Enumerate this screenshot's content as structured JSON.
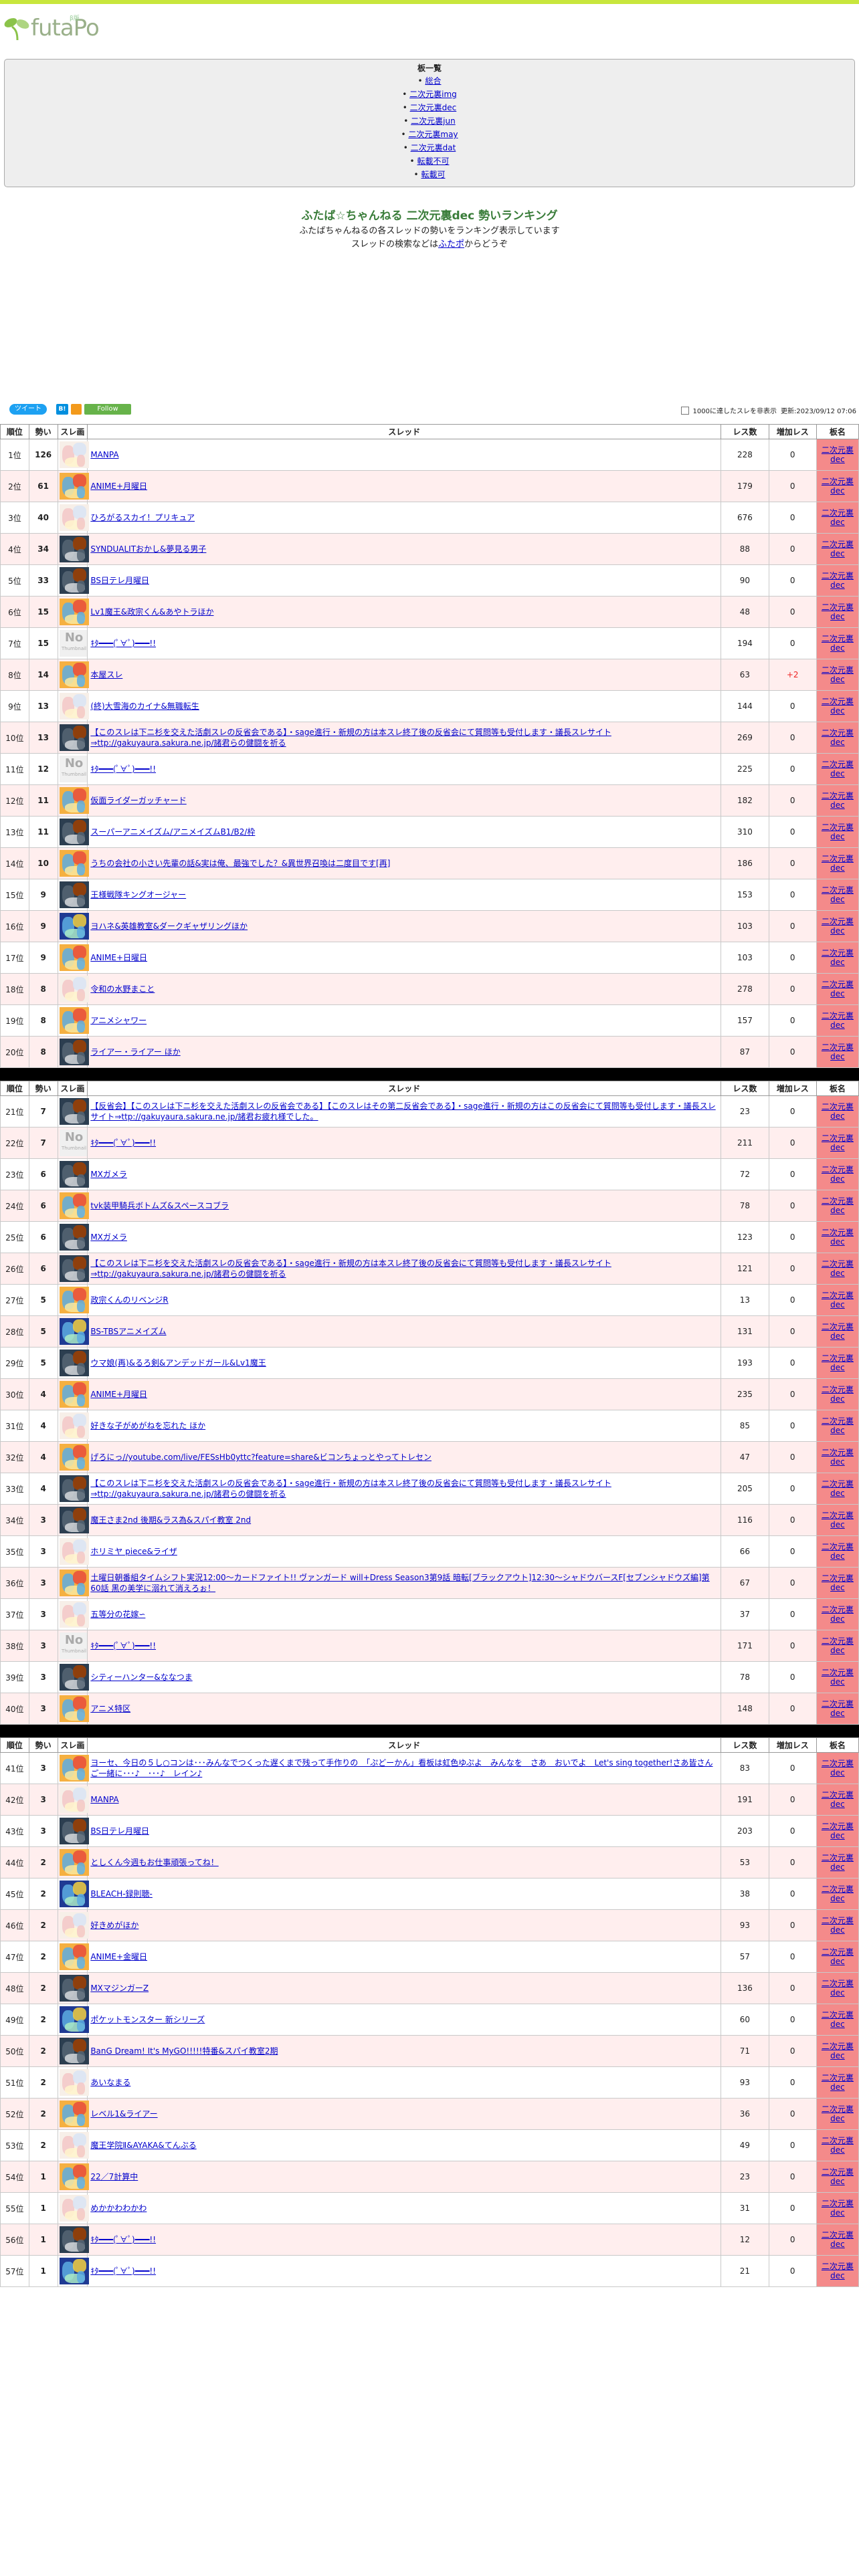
{
  "site": {
    "logo_text": "futaPo",
    "logo_small": "β版"
  },
  "menu": {
    "title": "板一覧",
    "items": [
      {
        "label": "総合"
      },
      {
        "label": "二次元裏img"
      },
      {
        "label": "二次元裏dec"
      },
      {
        "label": "二次元裏jun"
      },
      {
        "label": "二次元裏may"
      },
      {
        "label": "二次元裏dat"
      },
      {
        "label": "転載不可"
      },
      {
        "label": "転載可"
      }
    ]
  },
  "intro": {
    "title": "ふたば☆ちゃんねる 二次元裏dec 勢いランキング",
    "line1": "ふたばちゃんねるの各スレッドの勢いをランキング表示しています",
    "line2_pre": "スレッドの検索などは",
    "line2_link": "ふたポ",
    "line2_post": "からどうぞ"
  },
  "toolbar": {
    "tweet_label": "ツイート",
    "hatena_label": "B!",
    "follow_label": "Follow",
    "hide_label": "1000に達したスレを非表示",
    "updated_label": "更新:2023/09/12 07:06"
  },
  "table": {
    "headers": [
      "順位",
      "勢い",
      "スレ画",
      "スレッド",
      "レス数",
      "増加レス",
      "板名"
    ],
    "board_line1": "二次元裏",
    "board_line2": "dec"
  },
  "rows": [
    {
      "rank": "1位",
      "mom": "126",
      "title": "MANPA",
      "res": "228",
      "inc": "0",
      "thumb": "light"
    },
    {
      "rank": "2位",
      "mom": "61",
      "title": "ANIME+月曜日",
      "res": "179",
      "inc": "0",
      "thumb": "colorful"
    },
    {
      "rank": "3位",
      "mom": "40",
      "title": "ひろがるスカイ！プリキュア",
      "res": "676",
      "inc": "0",
      "thumb": "light"
    },
    {
      "rank": "4位",
      "mom": "34",
      "title": "SYNDUALITおかし&夢見る男子",
      "res": "88",
      "inc": "0",
      "thumb": "dark"
    },
    {
      "rank": "5位",
      "mom": "33",
      "title": "BS日テレ月曜日",
      "res": "90",
      "inc": "0",
      "thumb": "dark"
    },
    {
      "rank": "6位",
      "mom": "15",
      "title": "Lv1魔王&政宗くん&あやトラほか",
      "res": "48",
      "inc": "0",
      "thumb": "colorful"
    },
    {
      "rank": "7位",
      "mom": "15",
      "title": "ｷﾀ━━━(ﾟ∀ﾟ)━━━!!",
      "res": "194",
      "inc": "0",
      "thumb": "none"
    },
    {
      "rank": "8位",
      "mom": "14",
      "title": "本屋スレ",
      "res": "63",
      "inc": "+2",
      "thumb": "colorful"
    },
    {
      "rank": "9位",
      "mom": "13",
      "title": "(終)大雪海のカイナ&無職転生",
      "res": "144",
      "inc": "0",
      "thumb": "light"
    },
    {
      "rank": "10位",
      "mom": "13",
      "title": "【このスレは下ニ杉を交えた活劇スレの反省会である】・sage進行・新規の方は本スレ終了後の反省会にて質問等も受付します・議長スレサイト⇒ttp://gakuyaura.sakura.ne.jp/諸君らの健闘を祈る",
      "res": "269",
      "inc": "0",
      "thumb": "dark"
    },
    {
      "rank": "11位",
      "mom": "12",
      "title": "ｷﾀ━━━(ﾟ∀ﾟ)━━━!!",
      "res": "225",
      "inc": "0",
      "thumb": "none"
    },
    {
      "rank": "12位",
      "mom": "11",
      "title": "仮面ライダーガッチャード",
      "res": "182",
      "inc": "0",
      "thumb": "colorful"
    },
    {
      "rank": "13位",
      "mom": "11",
      "title": "スーパーアニメイズム/アニメイズムB1/B2/枠",
      "res": "310",
      "inc": "0",
      "thumb": "dark"
    },
    {
      "rank": "14位",
      "mom": "10",
      "title": "うちの会社の小さい先輩の話&実は俺、最強でした？&異世界召喚は二度目です[再]",
      "res": "186",
      "inc": "0",
      "thumb": "colorful"
    },
    {
      "rank": "15位",
      "mom": "9",
      "title": "王様戦隊キングオージャー",
      "res": "153",
      "inc": "0",
      "thumb": "dark"
    },
    {
      "rank": "16位",
      "mom": "9",
      "title": "ヨハネ&英雄教室&ダークギャザリングほか",
      "res": "103",
      "inc": "0",
      "thumb": "blue"
    },
    {
      "rank": "17位",
      "mom": "9",
      "title": "ANIME+日曜日",
      "res": "103",
      "inc": "0",
      "thumb": "colorful"
    },
    {
      "rank": "18位",
      "mom": "8",
      "title": "令和の水野まこと",
      "res": "278",
      "inc": "0",
      "thumb": "light"
    },
    {
      "rank": "19位",
      "mom": "8",
      "title": "アニメシャワー",
      "res": "157",
      "inc": "0",
      "thumb": "colorful"
    },
    {
      "rank": "20位",
      "mom": "8",
      "title": "ライアー・ライアー ほか",
      "res": "87",
      "inc": "0",
      "thumb": "dark"
    },
    {
      "rank": "21位",
      "mom": "7",
      "title": "【反省会】【このスレは下ニ杉を交えた活劇スレの反省会である】【このスレはその第二反省会である】・sage進行・新規の方はこの反省会にて質問等も受付します・議長スレサイト⇒ttp://gakuyaura.sakura.ne.jp/諸君お疲れ様でした。",
      "res": "23",
      "inc": "0",
      "thumb": "dark"
    },
    {
      "rank": "22位",
      "mom": "7",
      "title": "ｷﾀ━━━(ﾟ∀ﾟ)━━━!!",
      "res": "211",
      "inc": "0",
      "thumb": "none"
    },
    {
      "rank": "23位",
      "mom": "6",
      "title": "MXガメラ",
      "res": "72",
      "inc": "0",
      "thumb": "dark"
    },
    {
      "rank": "24位",
      "mom": "6",
      "title": "tvk装甲騎兵ボトムズ&スペースコブラ",
      "res": "78",
      "inc": "0",
      "thumb": "colorful"
    },
    {
      "rank": "25位",
      "mom": "6",
      "title": "MXガメラ",
      "res": "123",
      "inc": "0",
      "thumb": "dark"
    },
    {
      "rank": "26位",
      "mom": "6",
      "title": "【このスレは下ニ杉を交えた活劇スレの反省会である】・sage進行・新規の方は本スレ終了後の反省会にて質問等も受付します・議長スレサイト⇒ttp://gakuyaura.sakura.ne.jp/諸君らの健闘を祈る",
      "res": "121",
      "inc": "0",
      "thumb": "dark"
    },
    {
      "rank": "27位",
      "mom": "5",
      "title": "政宗くんのリベンジR",
      "res": "13",
      "inc": "0",
      "thumb": "colorful"
    },
    {
      "rank": "28位",
      "mom": "5",
      "title": "BS-TBSアニメイズム",
      "res": "131",
      "inc": "0",
      "thumb": "blue"
    },
    {
      "rank": "29位",
      "mom": "5",
      "title": "ウマ娘(再)&るろ剣&アンデッドガール&Lv1魔王",
      "res": "193",
      "inc": "0",
      "thumb": "dark"
    },
    {
      "rank": "30位",
      "mom": "4",
      "title": "ANIME+月曜日",
      "res": "235",
      "inc": "0",
      "thumb": "colorful"
    },
    {
      "rank": "31位",
      "mom": "4",
      "title": "好きな子がめがねを忘れた ほか",
      "res": "85",
      "inc": "0",
      "thumb": "light"
    },
    {
      "rank": "32位",
      "mom": "4",
      "title": "げろにっ//youtube.com/live/FESsHb0yttc?feature=share&ビコンちょっとやってトレセン",
      "res": "47",
      "inc": "0",
      "thumb": "colorful"
    },
    {
      "rank": "33位",
      "mom": "4",
      "title": "【このスレは下ニ杉を交えた活劇スレの反省会である】・sage進行・新規の方は本スレ終了後の反省会にて質問等も受付します・議長スレサイト⇒ttp://gakuyaura.sakura.ne.jp/諸君らの健闘を祈る",
      "res": "205",
      "inc": "0",
      "thumb": "dark"
    },
    {
      "rank": "34位",
      "mom": "3",
      "title": "魔王さま2nd 後期&ラス為&スパイ教室 2nd",
      "res": "116",
      "inc": "0",
      "thumb": "dark"
    },
    {
      "rank": "35位",
      "mom": "3",
      "title": "ホリミヤ piece&ライザ",
      "res": "66",
      "inc": "0",
      "thumb": "light"
    },
    {
      "rank": "36位",
      "mom": "3",
      "title": "土曜日朝番組タイムシフト実況12:00～カードファイト!! ヴァンガード will+Dress Season3第9話 暗転[ブラックアウト]12:30～シャドウバースF[セブンシャドウズ編]第60話 黒の美学に溺れて消えろぉ！",
      "res": "67",
      "inc": "0",
      "thumb": "colorful"
    },
    {
      "rank": "37位",
      "mom": "3",
      "title": "五等分の花嫁∽",
      "res": "37",
      "inc": "0",
      "thumb": "light"
    },
    {
      "rank": "38位",
      "mom": "3",
      "title": "ｷﾀ━━━(ﾟ∀ﾟ)━━━!!",
      "res": "171",
      "inc": "0",
      "thumb": "none"
    },
    {
      "rank": "39位",
      "mom": "3",
      "title": "シティーハンター&ななつま",
      "res": "78",
      "inc": "0",
      "thumb": "dark"
    },
    {
      "rank": "40位",
      "mom": "3",
      "title": "アニメ特区",
      "res": "148",
      "inc": "0",
      "thumb": "colorful"
    },
    {
      "rank": "41位",
      "mom": "3",
      "title": "ヨーセ、今日の５し○コンは･･･みんなでつくった遅くまで残って手作りの　「ぷどーかん」看板は虹色ゆぷよ　みんなを　さあ　おいでよ　Let's sing together!さあ皆さんご一緒に･･･♪　･･･♪　レイン♪",
      "res": "83",
      "inc": "0",
      "thumb": "colorful"
    },
    {
      "rank": "42位",
      "mom": "3",
      "title": "MANPA",
      "res": "191",
      "inc": "0",
      "thumb": "light"
    },
    {
      "rank": "43位",
      "mom": "3",
      "title": "BS日テレ月曜日",
      "res": "203",
      "inc": "0",
      "thumb": "dark"
    },
    {
      "rank": "44位",
      "mom": "2",
      "title": "としくん今週もお仕事頑張ってね！",
      "res": "53",
      "inc": "0",
      "thumb": "colorful"
    },
    {
      "rank": "45位",
      "mom": "2",
      "title": "BLEACH-録則聴-",
      "res": "38",
      "inc": "0",
      "thumb": "blue"
    },
    {
      "rank": "46位",
      "mom": "2",
      "title": "好きめがほか",
      "res": "93",
      "inc": "0",
      "thumb": "light"
    },
    {
      "rank": "47位",
      "mom": "2",
      "title": "ANIME+金曜日",
      "res": "57",
      "inc": "0",
      "thumb": "colorful"
    },
    {
      "rank": "48位",
      "mom": "2",
      "title": "MXマジンガーZ",
      "res": "136",
      "inc": "0",
      "thumb": "dark"
    },
    {
      "rank": "49位",
      "mom": "2",
      "title": "ポケットモンスター 新シリーズ",
      "res": "60",
      "inc": "0",
      "thumb": "blue"
    },
    {
      "rank": "50位",
      "mom": "2",
      "title": "BanG Dream! It's MyGO!!!!!特番&スパイ教室2期",
      "res": "71",
      "inc": "0",
      "thumb": "dark"
    },
    {
      "rank": "51位",
      "mom": "2",
      "title": "あいなまる",
      "res": "93",
      "inc": "0",
      "thumb": "light"
    },
    {
      "rank": "52位",
      "mom": "2",
      "title": "レベル1&ライアー",
      "res": "36",
      "inc": "0",
      "thumb": "colorful"
    },
    {
      "rank": "53位",
      "mom": "2",
      "title": "魔王学院Ⅱ&AYAKA&てんぷる",
      "res": "49",
      "inc": "0",
      "thumb": "light"
    },
    {
      "rank": "54位",
      "mom": "1",
      "title": "22／7計算中",
      "res": "23",
      "inc": "0",
      "thumb": "colorful"
    },
    {
      "rank": "55位",
      "mom": "1",
      "title": "めかかわわかわ",
      "res": "31",
      "inc": "0",
      "thumb": "light"
    },
    {
      "rank": "56位",
      "mom": "1",
      "title": "ｷﾀ━━━(ﾟ∀ﾟ)━━━!!",
      "res": "12",
      "inc": "0",
      "thumb": "dark"
    },
    {
      "rank": "57位",
      "mom": "1",
      "title": "ｷﾀ━━━(ﾟ∀ﾟ)━━━!!",
      "res": "21",
      "inc": "0",
      "thumb": "blue"
    }
  ],
  "nothumb": {
    "big": "No",
    "small": "Thumbnail"
  },
  "colors": {
    "accent_green": "#c8e63c",
    "board_cell": "#f48a8a",
    "row_alt": "#ffeeee",
    "increase": "#ee2222"
  }
}
